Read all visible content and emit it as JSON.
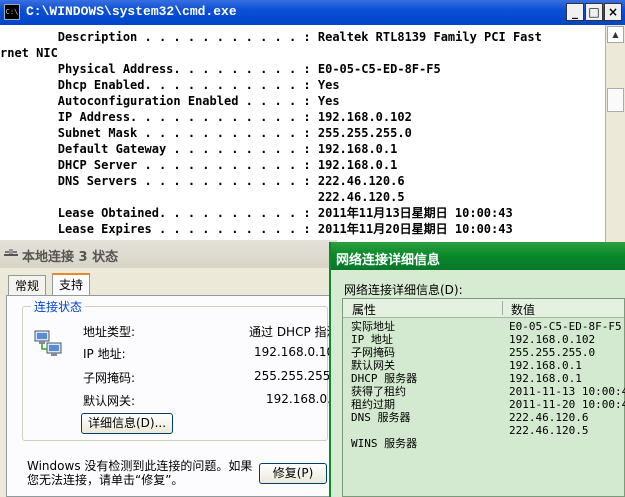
{
  "cmd": {
    "title": "C:\\WINDOWS\\system32\\cmd.exe",
    "icon_text": "C:\\",
    "buttons": {
      "minimize": "_",
      "maximize": "□",
      "close": "×"
    },
    "lines": [
      "        Description . . . . . . . . . . . : Realtek RTL8139 Family PCI Fast",
      "rnet NIC",
      "        Physical Address. . . . . . . . . : E0-05-C5-ED-8F-F5",
      "        Dhcp Enabled. . . . . . . . . . . : Yes",
      "        Autoconfiguration Enabled . . . . : Yes",
      "        IP Address. . . . . . . . . . . . : 192.168.0.102",
      "        Subnet Mask . . . . . . . . . . . : 255.255.255.0",
      "        Default Gateway . . . . . . . . . : 192.168.0.1",
      "        DHCP Server . . . . . . . . . . . : 192.168.0.1",
      "        DNS Servers . . . . . . . . . . . : 222.46.120.6",
      "                                            222.46.120.5",
      "        Lease Obtained. . . . . . . . . . : 2011年11月13日星期日 10:00:43",
      "        Lease Expires . . . . . . . . . . : 2011年11月20日星期日 10:00:43"
    ],
    "scroll_up": "▲",
    "scroll_down": "▼"
  },
  "status_dialog": {
    "title": "本地连接 3 状态",
    "tabs": [
      "常规",
      "支持"
    ],
    "group_label": "连接状态",
    "rows": [
      {
        "label": "地址类型:",
        "value": "通过 DHCP 指派"
      },
      {
        "label": "IP 地址:",
        "value": "192.168.0.102"
      },
      {
        "label": "子网掩码:",
        "value": "255.255.255.0"
      },
      {
        "label": "默认网关:",
        "value": "192.168.0.1"
      }
    ],
    "details_button": "详细信息(D)...",
    "repair_message": "Windows 没有检测到此连接的问题。如果您无法连接，请单击“修复”。",
    "repair_button": "修复(P)"
  },
  "details_dialog": {
    "title": "网络连接详细信息",
    "label": "网络连接详细信息(D):",
    "columns": [
      "属性",
      "数值"
    ],
    "rows": [
      {
        "prop": "实际地址",
        "val": "E0-05-C5-ED-8F-F5"
      },
      {
        "prop": "IP 地址",
        "val": "192.168.0.102"
      },
      {
        "prop": "子网掩码",
        "val": "255.255.255.0"
      },
      {
        "prop": "默认网关",
        "val": "192.168.0.1"
      },
      {
        "prop": "DHCP 服务器",
        "val": "192.168.0.1"
      },
      {
        "prop": "获得了租约",
        "val": "2011-11-13 10:00:43"
      },
      {
        "prop": "租约过期",
        "val": "2011-11-20 10:00:43"
      },
      {
        "prop": "DNS 服务器",
        "val": "222.46.120.6"
      },
      {
        "prop": "",
        "val": "222.46.120.5"
      },
      {
        "prop": "WINS 服务器",
        "val": ""
      }
    ]
  }
}
